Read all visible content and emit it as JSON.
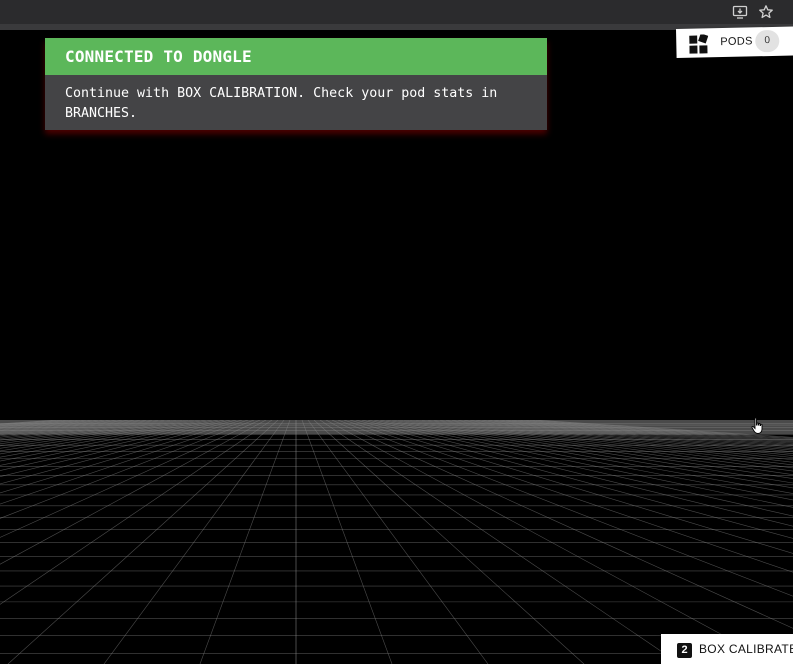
{
  "browser": {
    "icons": [
      "install-app-icon",
      "bookmark-star-icon"
    ]
  },
  "notice": {
    "title": "CONNECTED TO DONGLE",
    "message_line1": "Continue with BOX CALIBRATION. Check your pod stats in",
    "message_line2": "BRANCHES.",
    "header_color": "#5cb75a",
    "body_color": "#444446"
  },
  "pods": {
    "label": "PODS",
    "count": "0",
    "icon": "pods-grid-icon"
  },
  "box_calibrate": {
    "step": "2",
    "label": "BOX CALIBRATE"
  },
  "colors": {
    "background": "#000000",
    "grid_line": "#8a8a8a"
  }
}
